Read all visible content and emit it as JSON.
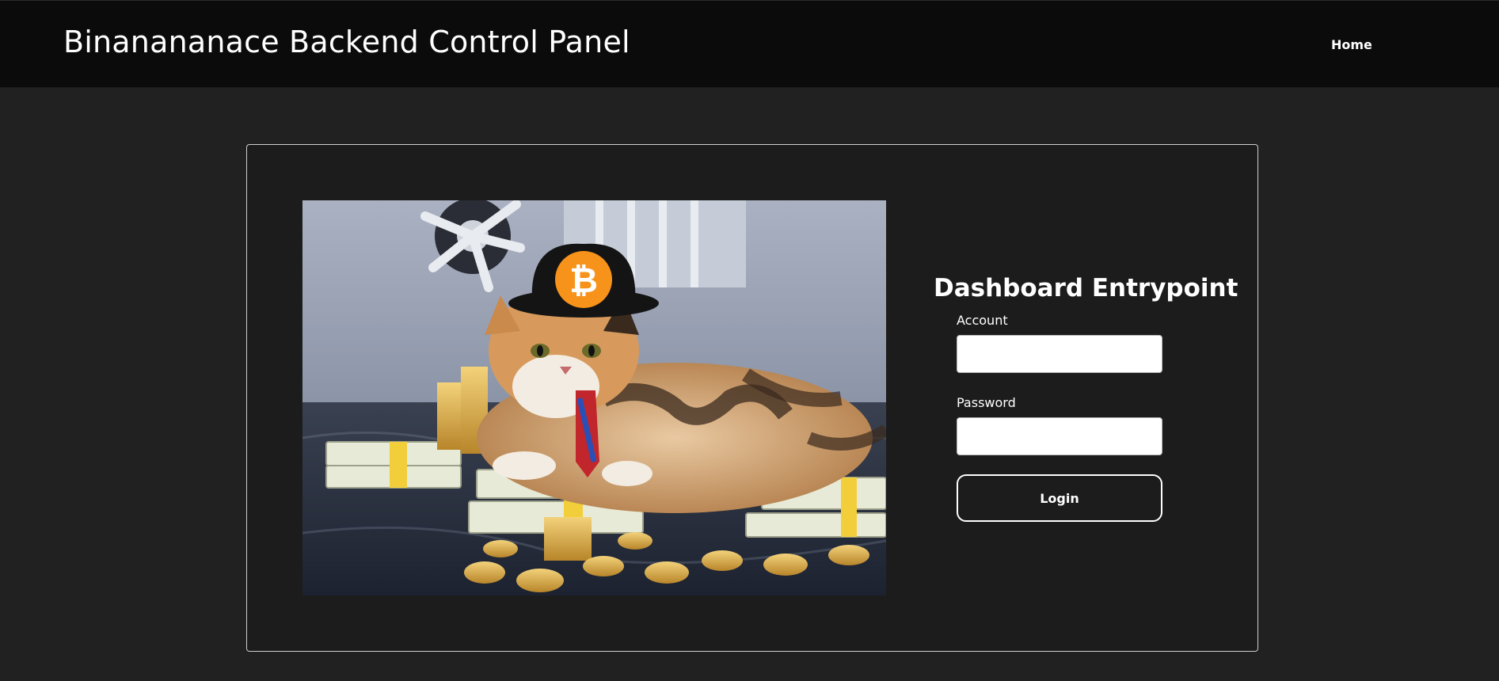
{
  "header": {
    "brand": "Binanananace Backend Control Panel",
    "nav_home": "Home"
  },
  "hero_image": {
    "alt": "Calico cat wearing a bitcoin hat and tie, lying on stacks of cash and gold coins",
    "bitcoin_symbol": "₿"
  },
  "login": {
    "title": "Dashboard Entrypoint",
    "account_label": "Account",
    "account_value": "",
    "password_label": "Password",
    "password_value": "",
    "button_label": "Login"
  },
  "colors": {
    "page_bg": "#212121",
    "navbar_bg": "#0b0b0b",
    "card_bg": "#1c1c1c",
    "bitcoin_orange": "#f7931a"
  }
}
